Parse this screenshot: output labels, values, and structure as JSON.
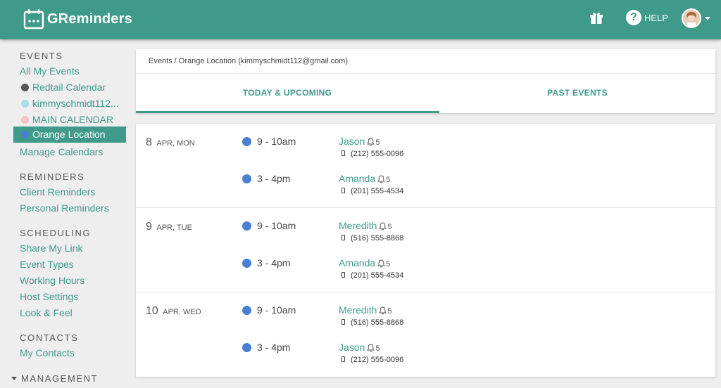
{
  "app": {
    "brand": "GReminders",
    "help_label": "HELP"
  },
  "icons": {
    "logo": "calendar-logo-icon",
    "gift": "gift-icon",
    "help": "help-icon",
    "avatar": "user-avatar",
    "caret": "caret-down-icon",
    "bell": "bell-icon",
    "phone": "phone-icon"
  },
  "colors": {
    "brand": "#3f9a8a",
    "event_dot": "#4a7fd6",
    "redtail": "#555555",
    "kimmy": "#a8dde8",
    "main": "#f6c1c7",
    "orange": "#4a7fd6"
  },
  "sidebar": {
    "events_head": "EVENTS",
    "all_events": "All My Events",
    "calendars": [
      {
        "label": "Redtail Calendar"
      },
      {
        "label": "kimmyschmidt112..."
      },
      {
        "label": "MAIN CALENDAR"
      },
      {
        "label": "Orange Location"
      }
    ],
    "manage_calendars": "Manage Calendars",
    "reminders_head": "REMINDERS",
    "client_reminders": "Client Reminders",
    "personal_reminders": "Personal Reminders",
    "scheduling_head": "SCHEDULING",
    "share_link": "Share My Link",
    "event_types": "Event Types",
    "working_hours": "Working Hours",
    "host_settings": "Host Settings",
    "look_feel": "Look & Feel",
    "contacts_head": "CONTACTS",
    "my_contacts": "My Contacts",
    "management_head": "MANAGEMENT"
  },
  "header": {
    "breadcrumb": "Events / Orange Location (kimmyschmidt112@gmail.com)",
    "tab_upcoming": "TODAY & UPCOMING",
    "tab_past": "PAST EVENTS"
  },
  "days": [
    {
      "num": "8",
      "sub": "APR, MON",
      "events": [
        {
          "time": "9 - 10am",
          "name": "Jason",
          "reminders": "5",
          "phone": "(212) 555-0096"
        },
        {
          "time": "3 - 4pm",
          "name": "Amanda",
          "reminders": "5",
          "phone": "(201) 555-4534"
        }
      ]
    },
    {
      "num": "9",
      "sub": "APR, TUE",
      "events": [
        {
          "time": "9 - 10am",
          "name": "Meredith",
          "reminders": "5",
          "phone": "(516) 555-8868"
        },
        {
          "time": "3 - 4pm",
          "name": "Amanda",
          "reminders": "5",
          "phone": "(201) 555-4534"
        }
      ]
    },
    {
      "num": "10",
      "sub": "APR, WED",
      "events": [
        {
          "time": "9 - 10am",
          "name": "Meredith",
          "reminders": "5",
          "phone": "(516) 555-8868"
        },
        {
          "time": "3 - 4pm",
          "name": "Jason",
          "reminders": "5",
          "phone": "(212) 555-0096"
        }
      ]
    }
  ]
}
